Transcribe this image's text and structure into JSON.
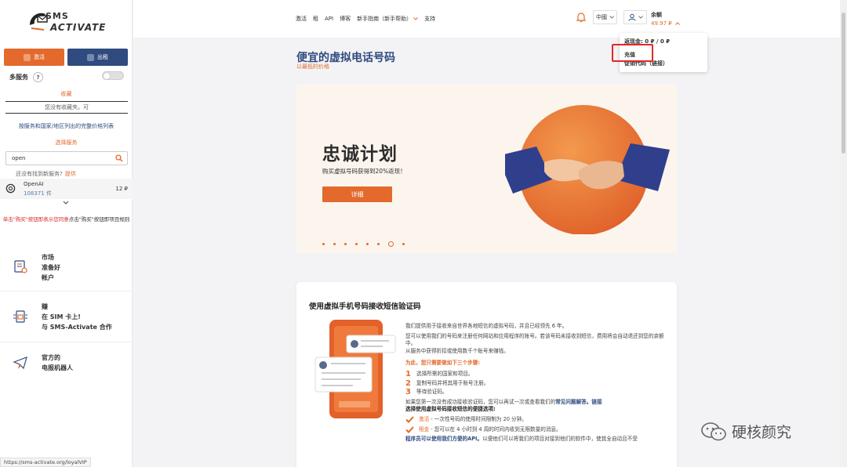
{
  "sidebar": {
    "logo_line1": "SMS",
    "logo_line2": "ACTIVATE",
    "btn_activate": "激活",
    "btn_rent": "出租",
    "multi_service": "多服务",
    "help_mark": "?",
    "favorites_title": "收藏",
    "favorites_empty": "您没有收藏夹。可",
    "price_list_link": "按服务和国家/地区列出的完整价格列表",
    "choose_service": "选择服务",
    "search_value": "open",
    "not_found_text": "还没有找到新服务?",
    "not_found_link": "提供",
    "service": {
      "name": "OpenAI",
      "count": "108371 件",
      "price": "12 ₽"
    },
    "buy_note_red": "单击\"购买\"按钮即表示您同意",
    "buy_note_rest": "点击\"购买\"按钮即项目规则",
    "promos": [
      {
        "lines": [
          "市场",
          "准备好",
          "帐户"
        ],
        "icon": "market-icon"
      },
      {
        "lines": [
          "赚",
          "在 SIM 卡上!",
          "与 SMS-Activate 合作"
        ],
        "icon": "sim-icon"
      },
      {
        "lines": [
          "官方的",
          "电报机器人"
        ],
        "icon": "telegram-icon"
      }
    ],
    "status_url": "https://sms-activate.org/loyalVIP"
  },
  "header": {
    "nav": [
      "激活",
      "租",
      "API",
      "博客",
      "新手指南（新手帮助）",
      "支持"
    ],
    "lang": "中國",
    "balance_label": "余额",
    "balance_value": "49.97 ₽"
  },
  "dropdown": {
    "cashback": "返现金: 0 ₽ / 0 ₽",
    "topup": "充值",
    "promo_code": "促销代码（链接）"
  },
  "main": {
    "title": "便宜的虚拟电话号码",
    "subtitle": "以最低的价格",
    "banner": {
      "title": "忠诚计划",
      "subtitle": "购买虚拟号码获得到20%返现！",
      "button": "详细"
    },
    "card": {
      "title": "使用虚拟手机号码接收短信验证码",
      "p1": "我们提供用于接收来自世界各地短信的虚拟号码，并且已经领先 6 年。",
      "p2": "您可以使用我们的号码来注册任何网站和应用程序的账号。若该号码未接收到短信，费用将会自动退还到您的余额中。",
      "p3": "从服务中获得折扣或使用数千个账号来赚钱。",
      "why": "为此，您只需要做如下三个步骤:",
      "steps": [
        "选择所需的国家和项目。",
        "复制号码并将其用于账号注册。",
        "等待验证码。"
      ],
      "p4a": "如果您第一次没有成功接收验证码，您可以再试一次或查看我们的",
      "p4b": "常见问题解答。链接",
      "options_title": "选择使用虚拟号码接收短信的便捷选项:",
      "opt1a": "激活",
      "opt1b": " - 一次性号码的使用时间限制为 20 分钟。",
      "opt2a": "租金",
      "opt2b": " - 您可以在 4 小时到 4 周的时间内收到无限数量的消息。",
      "p5a": "程序员可以使用我们方便的API。",
      "p5b": "以便他们可以将我们的项目对接到他们的软件中，使其全自动且不受"
    }
  },
  "watermark": "硬核颜究",
  "colors": {
    "accent": "#e36a2c",
    "navy": "#2f4b7f",
    "highlight": "#e32626"
  }
}
